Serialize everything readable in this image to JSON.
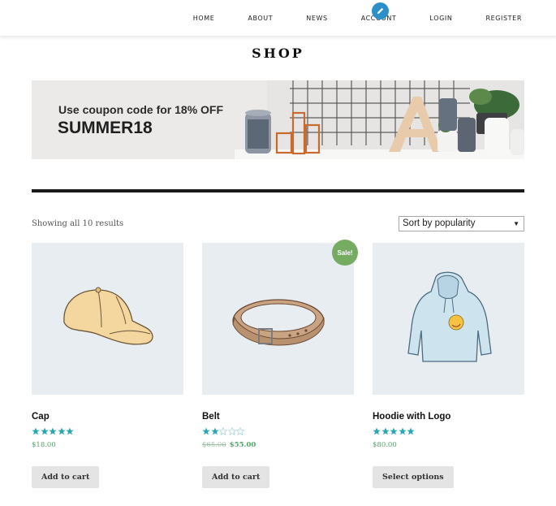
{
  "nav": {
    "items": [
      "HOME",
      "ABOUT",
      "NEWS",
      "ACCOUNT",
      "LOGIN",
      "REGISTER"
    ],
    "edit_icon": "pencil-icon",
    "edit_color": "#2d8fc7"
  },
  "page_title": "SHOP",
  "banner": {
    "line1": "Use coupon code for 18% OFF",
    "line2": "SUMMER18"
  },
  "shop": {
    "result_count": "Showing all 10 results",
    "sort_selected": "Sort by popularity"
  },
  "products": [
    {
      "name": "Cap",
      "rating": 5,
      "price": "$18.00",
      "button": "Add to cart",
      "icon": "cap-icon"
    },
    {
      "name": "Belt",
      "rating": 2,
      "price_old": "$65.00",
      "price": "$55.00",
      "sale_badge": "Sale!",
      "button": "Add to cart",
      "icon": "belt-icon"
    },
    {
      "name": "Hoodie with Logo",
      "rating": 5,
      "price": "$80.00",
      "button": "Select options",
      "icon": "hoodie-icon"
    }
  ],
  "colors": {
    "star": "#2aa6b5",
    "price": "#55a56b",
    "sale": "#76ab62",
    "product_bg": "#e7edf1"
  }
}
